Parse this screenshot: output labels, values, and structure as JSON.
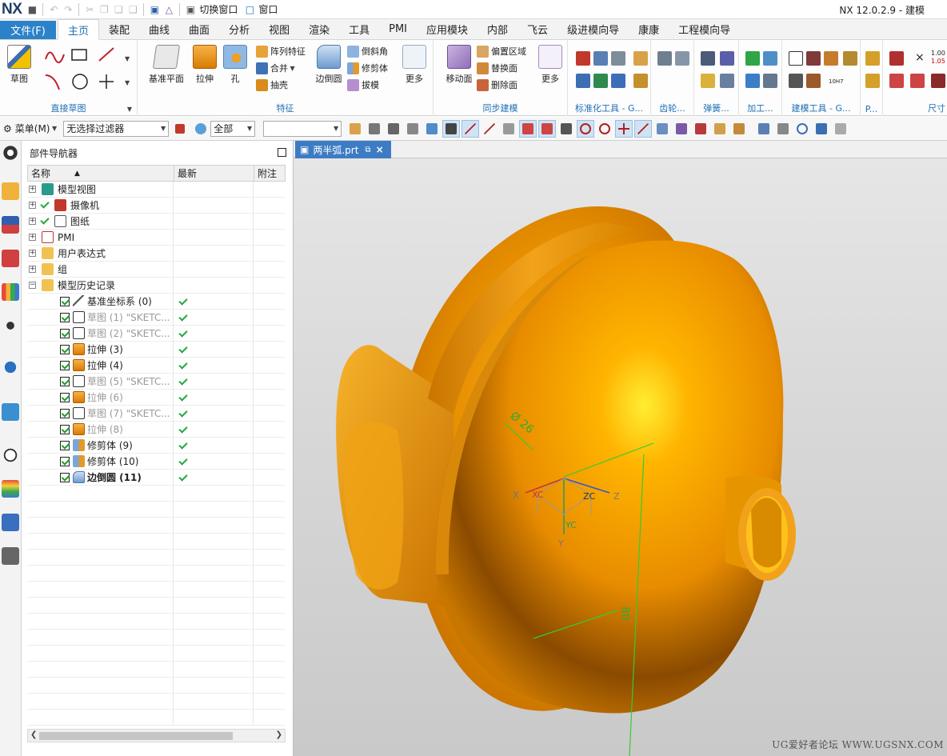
{
  "titlebar": {
    "logo": "NX",
    "switch_window": "切换窗口",
    "window_menu": "窗口",
    "app_title": "NX 12.0.2.9 - 建模"
  },
  "tabs": [
    "文件(F)",
    "主页",
    "装配",
    "曲线",
    "曲面",
    "分析",
    "视图",
    "渲染",
    "工具",
    "PMI",
    "应用模块",
    "内部",
    "飞云",
    "级进模向导",
    "康康",
    "工程模向导"
  ],
  "ribbon": {
    "sketch": "草图",
    "direct_sketch": "直接草图",
    "datum_plane": "基准平面",
    "extrude": "拉伸",
    "hole": "孔",
    "pattern_feature": "阵列特征",
    "unite": "合并",
    "shell": "抽壳",
    "edge_blend": "边倒圆",
    "chamfer": "倒斜角",
    "trim_body": "修剪体",
    "draft": "拔模",
    "more": "更多",
    "feature": "特征",
    "move_face": "移动面",
    "offset_region": "偏置区域",
    "replace_face": "替换面",
    "delete_face": "删除面",
    "sync_modeling": "同步建模",
    "standard_tools": "标准化工具 - G...",
    "gear": "齿轮...",
    "spring": "弹簧...",
    "machining": "加工...",
    "build_tools": "建模工具 - G...",
    "p_dots": "P...",
    "dimension": "尺寸",
    "tol_1": "1.00",
    "tol_2": "1.05",
    "tol_label": "10H7"
  },
  "toolbar": {
    "menu": "菜单(M)",
    "filter": "无选择过滤器",
    "scope": "全部"
  },
  "navigator": {
    "title": "部件导航器",
    "col_name": "名称",
    "col_latest": "最新",
    "col_note": "附注",
    "items": [
      {
        "label": "模型视图"
      },
      {
        "label": "摄像机"
      },
      {
        "label": "图纸"
      },
      {
        "label": "PMI"
      },
      {
        "label": "用户表达式"
      },
      {
        "label": "组"
      },
      {
        "label": "模型历史记录"
      },
      {
        "label": "基准坐标系 (0)"
      },
      {
        "label": "草图 (1) \"SKETC..."
      },
      {
        "label": "草图 (2) \"SKETC..."
      },
      {
        "label": "拉伸 (3)"
      },
      {
        "label": "拉伸 (4)"
      },
      {
        "label": "草图 (5) \"SKETC..."
      },
      {
        "label": "拉伸 (6)"
      },
      {
        "label": "草图 (7) \"SKETC..."
      },
      {
        "label": "拉伸 (8)"
      },
      {
        "label": "修剪体 (9)"
      },
      {
        "label": "修剪体 (10)"
      },
      {
        "label": "边倒圆 (11)"
      }
    ]
  },
  "graphics": {
    "tab": "两半弧.prt",
    "dim_diameter": "Ø 26",
    "dim_80": "80",
    "axis_x": "X",
    "axis_xc": "XC",
    "axis_zc": "ZC",
    "axis_z": "Z",
    "axis_yc": "YC",
    "axis_y": "Y",
    "watermark": "UG爱好者论坛 WWW.UGSNX.COM"
  },
  "colors": {
    "accent": "#2b82c9",
    "part": "#e89a0a",
    "check": "#22a83a",
    "dimension": "#33cc33"
  }
}
